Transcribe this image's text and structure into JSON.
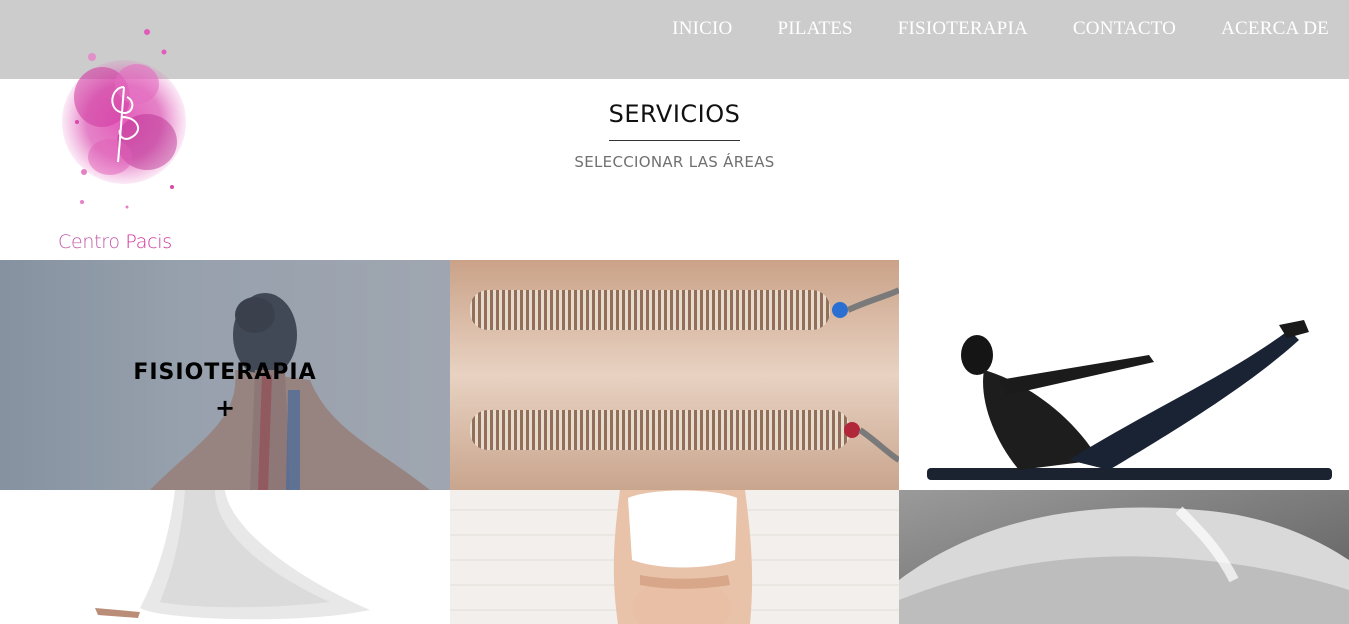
{
  "nav": {
    "items": [
      {
        "label": "INICIO"
      },
      {
        "label": "PILATES"
      },
      {
        "label": "FISIOTERAPIA"
      },
      {
        "label": "CONTACTO"
      },
      {
        "label": "ACERCA DE"
      }
    ]
  },
  "logo": {
    "word1": "Centro",
    "word2": "Pacis"
  },
  "services": {
    "title": "SERVICIOS",
    "subtitle": "SELECCIONAR LAS ÁREAS"
  },
  "tiles": [
    {
      "caption": "FISIOTERAPIA",
      "plus": "+"
    },
    {},
    {},
    {},
    {},
    {}
  ],
  "colors": {
    "header_bg": "#cccccc",
    "nav_text": "#ffffff",
    "logo_pink": "#d0309f",
    "logo_light": "#c05aa6"
  }
}
